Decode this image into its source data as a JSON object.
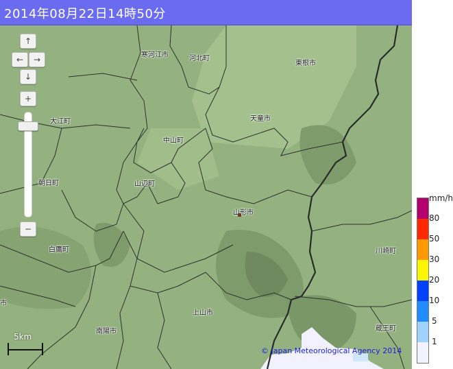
{
  "header": {
    "title": "2014年08月22日14時50分"
  },
  "controls": {
    "pan_up": "↑",
    "pan_left": "←",
    "pan_right": "→",
    "pan_down": "↓",
    "zoom_in": "+",
    "zoom_out": "−"
  },
  "map": {
    "municipalities": [
      {
        "name": "寒河江市"
      },
      {
        "name": "河北町"
      },
      {
        "name": "東根市"
      },
      {
        "name": "大江町"
      },
      {
        "name": "天童市"
      },
      {
        "name": "中山町"
      },
      {
        "name": "朝日町"
      },
      {
        "name": "山辺町"
      },
      {
        "name": "山形市"
      },
      {
        "name": "白鷹町"
      },
      {
        "name": "川崎町"
      },
      {
        "name": "上山市"
      },
      {
        "name": "南陽市"
      },
      {
        "name": "蔵王町"
      },
      {
        "name": "市"
      }
    ],
    "scale": "5km",
    "copyright": "© Japan Meteorological Agency 2014"
  },
  "legend": {
    "unit": "mm/h",
    "levels": [
      {
        "label": "80",
        "color": "#b4006e"
      },
      {
        "label": "50",
        "color": "#ff2800"
      },
      {
        "label": "30",
        "color": "#ff9900"
      },
      {
        "label": "20",
        "color": "#faf500"
      },
      {
        "label": "10",
        "color": "#0041ff"
      },
      {
        "label": "5",
        "color": "#218cff"
      },
      {
        "label": "1",
        "color": "#a0d2ff"
      },
      {
        "label": "",
        "color": "#f2f2ff"
      }
    ]
  },
  "colors": {
    "header_bg": "#6b6bf0",
    "land": "#8fae7b",
    "mountain": "#6f8a5f",
    "rain_light": "#f2f2ff"
  }
}
